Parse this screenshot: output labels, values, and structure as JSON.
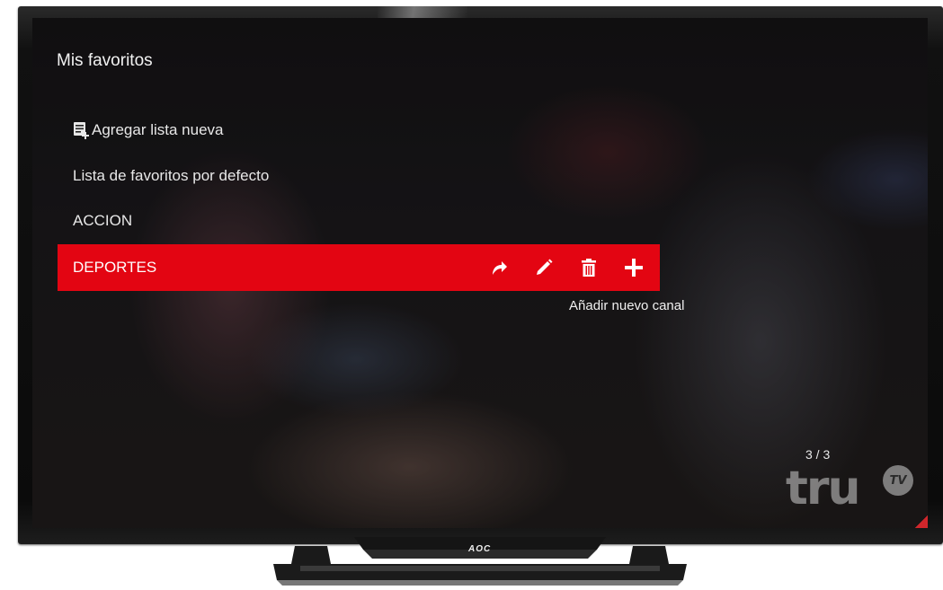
{
  "screen": {
    "title": "Mis favoritos",
    "menu": {
      "add_list_label": "Agregar lista nueva",
      "items": [
        "Lista de favoritos por defecto",
        "ACCION"
      ]
    },
    "selected_item": {
      "label": "DEPORTES",
      "actions": [
        {
          "icon": "share-arrow-icon"
        },
        {
          "icon": "pencil-icon"
        },
        {
          "icon": "trash-icon"
        },
        {
          "icon": "plus-icon"
        }
      ]
    },
    "tooltip": "Añadir nuevo canal",
    "page_counter": "3 / 3",
    "channel_logo": {
      "text": "tru",
      "badge": "TV"
    }
  },
  "tv": {
    "brand": "AOC"
  },
  "colors": {
    "selection": "#e30512",
    "text": "#f2f2f2"
  }
}
